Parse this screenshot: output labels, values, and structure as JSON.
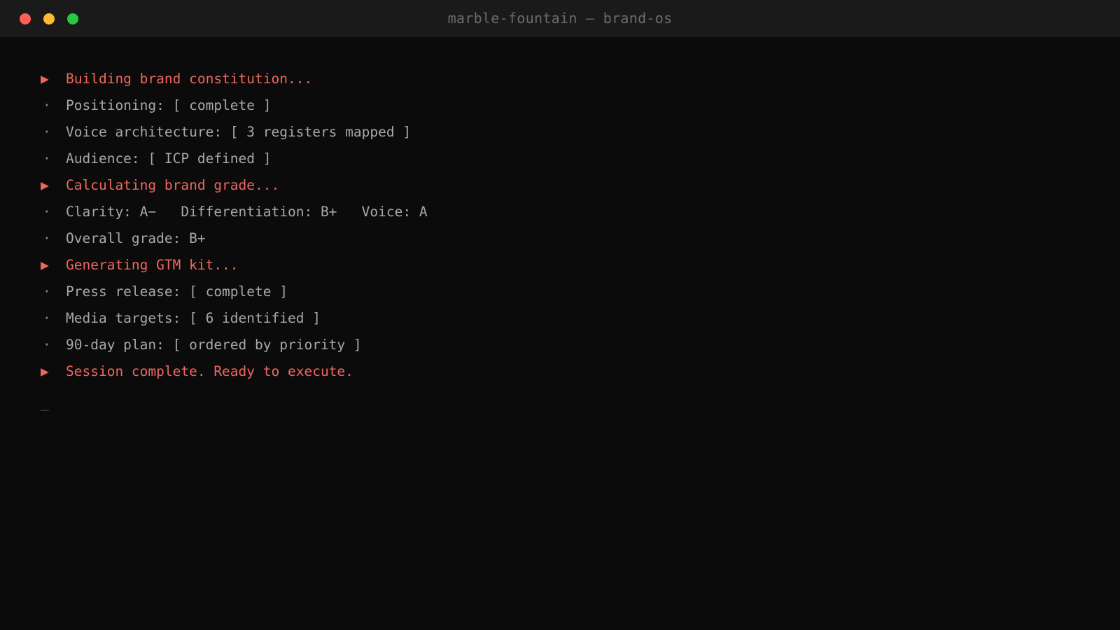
{
  "window": {
    "title": "marble-fountain — brand-os",
    "controls": {
      "close_color": "#ff5f57",
      "minimize_color": "#febc2e",
      "zoom_color": "#28c840"
    }
  },
  "colors": {
    "background": "#0b0b0b",
    "step_accent": "#f0675e",
    "info_text": "#a8a8a8",
    "title_text": "#6b6b6b"
  },
  "terminal": {
    "step_marker": "▶",
    "info_marker": "·",
    "cursor": "_",
    "lines": [
      {
        "kind": "step",
        "text": "Building brand constitution..."
      },
      {
        "kind": "info",
        "text": "Positioning: [ complete ]"
      },
      {
        "kind": "info",
        "text": "Voice architecture: [ 3 registers mapped ]"
      },
      {
        "kind": "info",
        "text": "Audience: [ ICP defined ]"
      },
      {
        "kind": "step",
        "text": "Calculating brand grade..."
      },
      {
        "kind": "info",
        "text": "Clarity: A−   Differentiation: B+   Voice: A"
      },
      {
        "kind": "info",
        "text": "Overall grade: B+"
      },
      {
        "kind": "step",
        "text": "Generating GTM kit..."
      },
      {
        "kind": "info",
        "text": "Press release: [ complete ]"
      },
      {
        "kind": "info",
        "text": "Media targets: [ 6 identified ]"
      },
      {
        "kind": "info",
        "text": "90-day plan: [ ordered by priority ]"
      },
      {
        "kind": "step",
        "text": "Session complete. Ready to execute."
      }
    ]
  }
}
